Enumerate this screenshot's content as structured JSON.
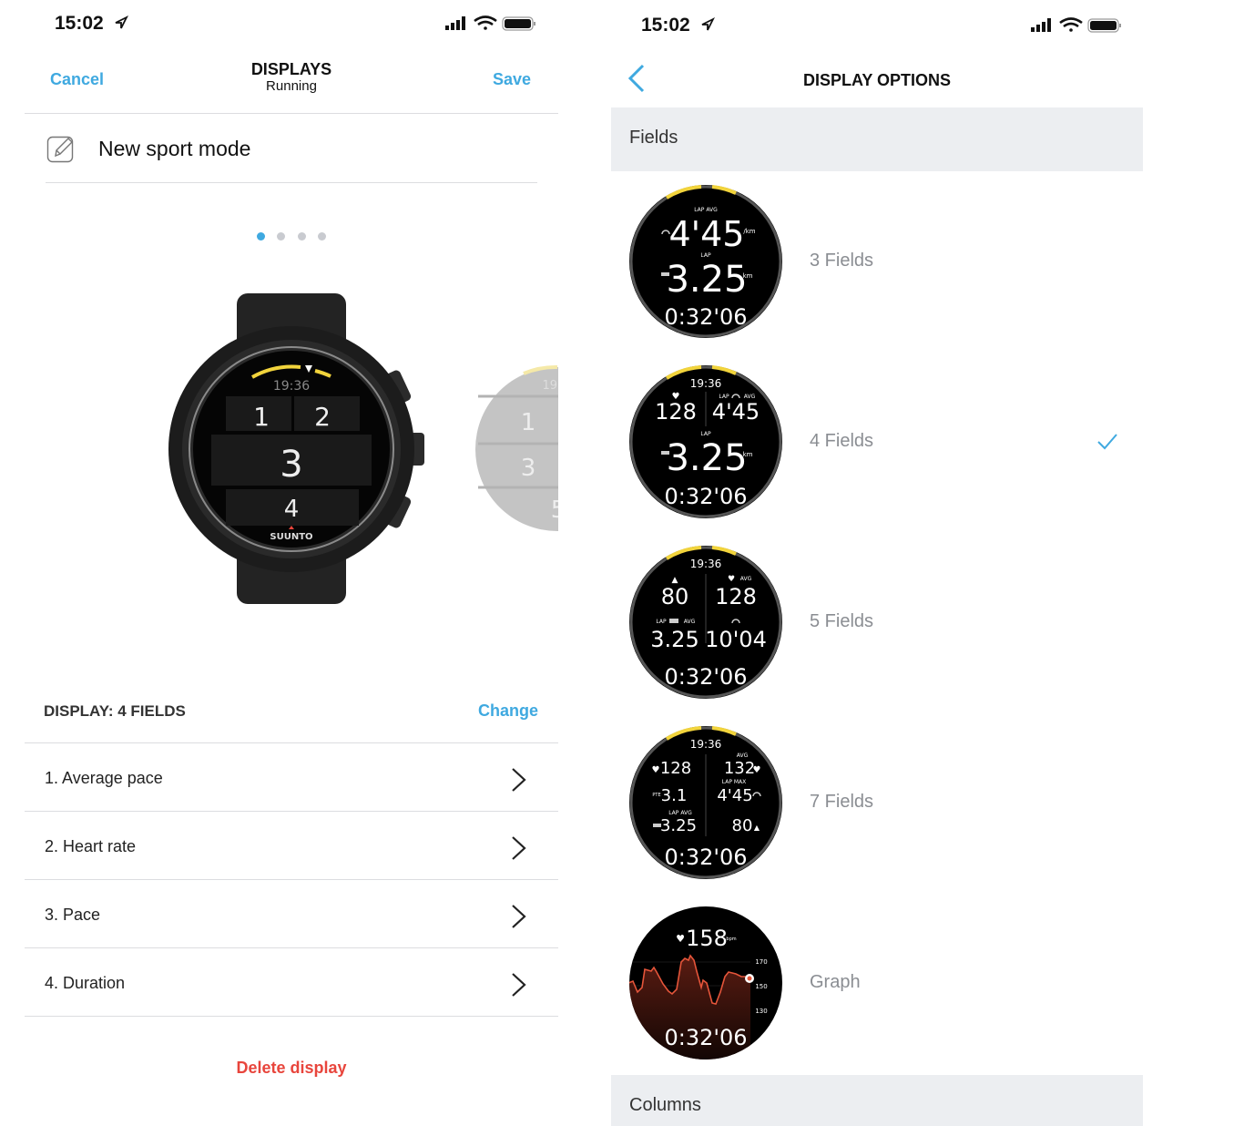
{
  "left": {
    "status": {
      "time": "15:02"
    },
    "nav": {
      "cancel": "Cancel",
      "title": "DISPLAYS",
      "subtitle": "Running",
      "save": "Save"
    },
    "name_field": {
      "value": "New sport mode"
    },
    "pager": {
      "count": 4,
      "active": 1
    },
    "watch": {
      "time": "19:36",
      "fields": [
        "1",
        "2",
        "3",
        "4"
      ],
      "brand": "SUUNTO",
      "next_preview": [
        "19:",
        "1",
        "3",
        "5"
      ]
    },
    "display_header": {
      "label": "DISPLAY: 4 FIELDS",
      "change": "Change"
    },
    "fields": [
      {
        "label": "1. Average pace"
      },
      {
        "label": "2. Heart rate"
      },
      {
        "label": "3. Pace"
      },
      {
        "label": "4. Duration"
      }
    ],
    "delete": "Delete display"
  },
  "right": {
    "status": {
      "time": "15:02"
    },
    "nav": {
      "title": "DISPLAY OPTIONS"
    },
    "sections": {
      "fields": "Fields",
      "columns": "Columns"
    },
    "options": [
      {
        "label": "3 Fields",
        "selected": false,
        "face": {
          "l1": "LAP AVG",
          "pace": "4'45",
          "pace_unit": "/km",
          "l2": "LAP",
          "dist": "3.25",
          "dist_unit": "km",
          "dur": "0:32'06"
        }
      },
      {
        "label": "4 Fields",
        "selected": true,
        "face": {
          "time": "19:36",
          "hr": "128",
          "l1": "LAP",
          "l1b": "AVG",
          "pace": "4'45",
          "l2": "LAP",
          "dist": "3.25",
          "dist_unit": "km",
          "dur": "0:32'06"
        }
      },
      {
        "label": "5 Fields",
        "selected": false,
        "face": {
          "time": "19:36",
          "cal": "80",
          "l_avg": "AVG",
          "hr": "128",
          "l_lap": "LAP",
          "l_avg2": "AVG",
          "dist": "3.25",
          "pace": "10'04",
          "dur": "0:32'06"
        }
      },
      {
        "label": "7 Fields",
        "selected": false,
        "face": {
          "time": "19:36",
          "hr": "128",
          "l_avg": "AVG",
          "hr_avg": "132",
          "pte_l": "PTE",
          "pte": "3.1",
          "l_lapmax": "LAP  MAX",
          "pace": "4'45",
          "l_lapavg": "LAP  AVG",
          "dist": "3.25",
          "cal": "80",
          "dur": "0:32'06"
        }
      },
      {
        "label": "Graph",
        "selected": false,
        "face": {
          "hr": "158",
          "unit": "bpm",
          "ticks": [
            "170",
            "150",
            "130"
          ],
          "dur": "0:32'06"
        }
      }
    ]
  },
  "colors": {
    "accent": "#3fa9e0",
    "danger": "#e8453c",
    "watch_yellow": "#f2d43c",
    "graph": "#e5553a"
  }
}
